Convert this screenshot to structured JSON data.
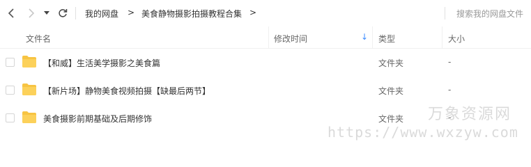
{
  "toolbar": {
    "breadcrumb": [
      "我的网盘",
      "美食静物摄影拍摄教程合集"
    ],
    "breadcrumb_separator": ">",
    "search_placeholder": "搜索我的网盘文件"
  },
  "columns": {
    "name": "文件名",
    "modified": "修改时间",
    "type": "类型",
    "size": "大小",
    "sort_indicator": "↓"
  },
  "files": [
    {
      "name": "【和威】生活美学摄影之美食篇",
      "type": "文件夹",
      "size": "-"
    },
    {
      "name": "【新片场】静物美食视频拍摄【缺最后两节】",
      "type": "文件夹",
      "size": "-"
    },
    {
      "name": "美食摄影前期基础及后期修饰",
      "type": "文件夹",
      "size": "-"
    }
  ],
  "watermark": {
    "text": "万象资源网",
    "url": "https://www.wxzyw.com"
  },
  "colors": {
    "folder": "#f7c443",
    "accent": "#3b8cff"
  },
  "icons": [
    "back-icon",
    "forward-icon",
    "dropdown-icon",
    "refresh-icon",
    "folder-icon",
    "sort-down-icon"
  ]
}
